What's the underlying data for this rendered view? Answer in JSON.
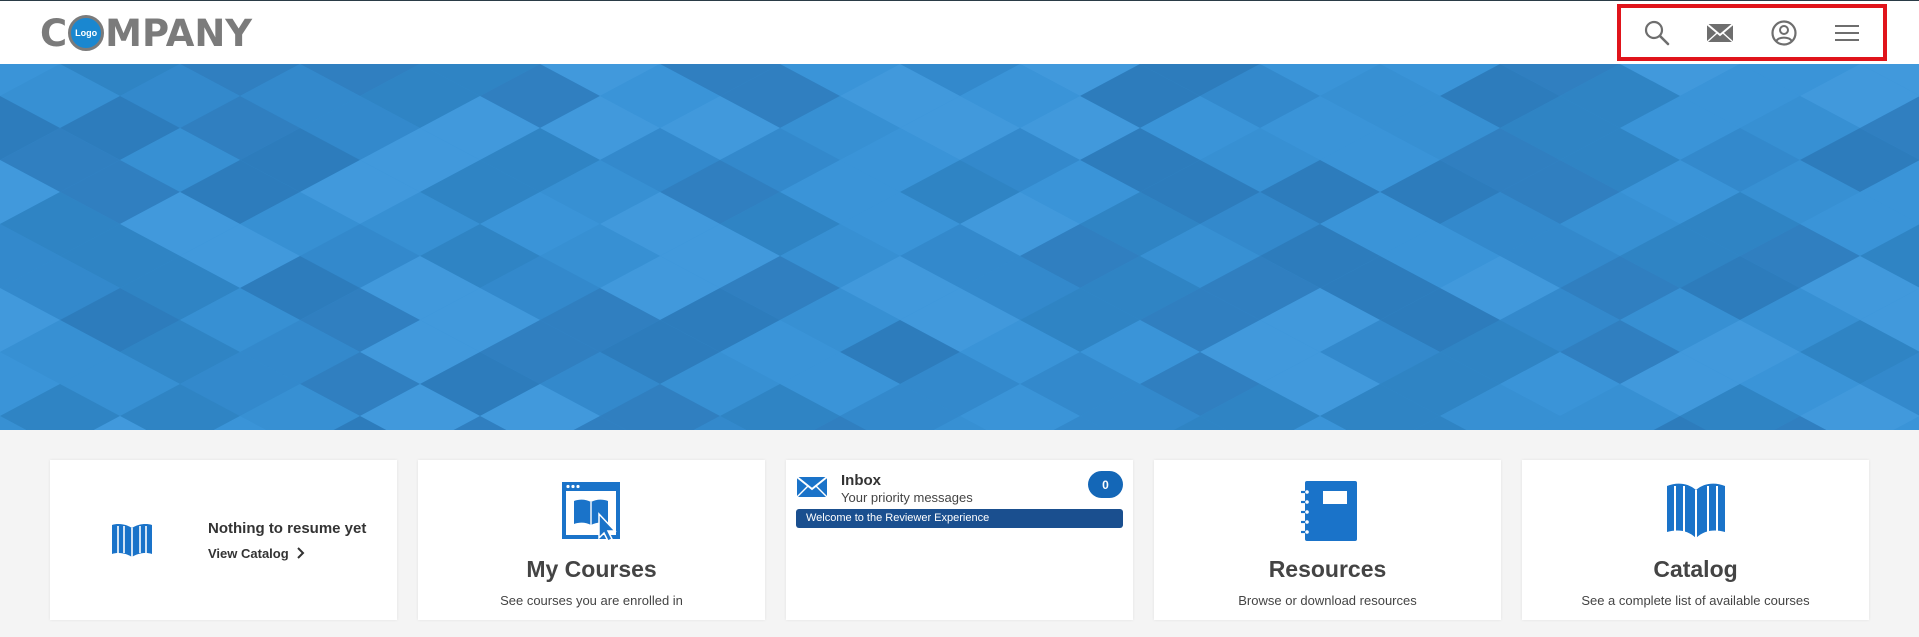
{
  "header": {
    "logo_text_before": "C",
    "logo_badge": "Logo",
    "logo_text_after": "MPANY",
    "icons": [
      "search-icon",
      "mail-icon",
      "user-icon",
      "menu-icon"
    ],
    "highlight_color": "#e0141b"
  },
  "hero": {
    "base_color": "#3793d6"
  },
  "cards": {
    "resume": {
      "title": "Nothing to resume yet",
      "link": "View Catalog"
    },
    "my_courses": {
      "title": "My Courses",
      "desc": "See courses you are enrolled in"
    },
    "inbox": {
      "title": "Inbox",
      "subtitle": "Your priority messages",
      "count": "0",
      "message": "Welcome to the Reviewer Experience"
    },
    "resources": {
      "title": "Resources",
      "desc": "Browse or download resources"
    },
    "catalog": {
      "title": "Catalog",
      "desc": "See a complete list of available courses"
    }
  },
  "colors": {
    "accent": "#1467b7",
    "icon_blue": "#1a73c9",
    "gray": "#7b7b7b"
  }
}
